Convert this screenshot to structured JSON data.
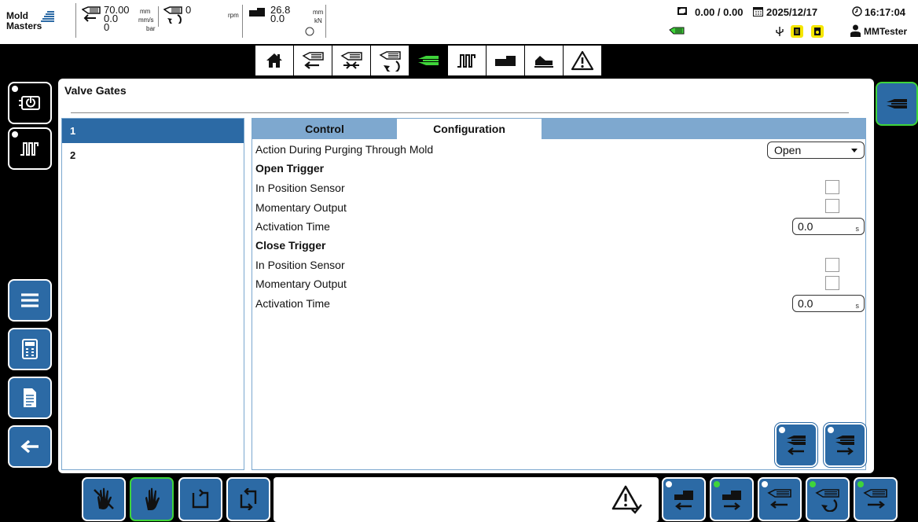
{
  "header": {
    "logo": {
      "line1": "Mold",
      "line2": "Masters"
    },
    "injection": {
      "position": "70.00",
      "speed": "0.0",
      "pressure": "0",
      "pos_unit": "mm",
      "speed_unit": "mm/s",
      "pressure_unit": "bar"
    },
    "screw": {
      "rpm_value": "0",
      "rpm_unit": "rpm"
    },
    "clamp": {
      "position": "26.8",
      "force": "0.0",
      "pos_unit": "mm",
      "force_unit": "kN"
    },
    "cycle": "0.00 / 0.00",
    "date": "2025/12/17",
    "time": "16:17:04",
    "user": "MMTester"
  },
  "nav": {
    "items": [
      "home-icon",
      "injection-icon",
      "hold-icon",
      "screw-icon",
      "valve-gate-icon",
      "temperature-icon",
      "ejector-icon",
      "graph-icon",
      "alarm-icon"
    ],
    "active_index": 4
  },
  "page": {
    "title": "Valve Gates",
    "gates": [
      "1",
      "2"
    ],
    "selected_gate": "1",
    "tabs": [
      "Control",
      "Configuration"
    ],
    "active_tab": "Configuration"
  },
  "config": {
    "purge_label": "Action During Purging Through Mold",
    "purge_value": "Open",
    "open_trigger": {
      "heading": "Open Trigger",
      "in_position_label": "In Position Sensor",
      "in_position_checked": false,
      "momentary_label": "Momentary Output",
      "momentary_checked": false,
      "activation_label": "Activation Time",
      "activation_value": "0.0",
      "activation_unit": "s"
    },
    "close_trigger": {
      "heading": "Close Trigger",
      "in_position_label": "In Position Sensor",
      "in_position_checked": false,
      "momentary_label": "Momentary Output",
      "momentary_checked": false,
      "activation_label": "Activation Time",
      "activation_value": "0.0",
      "activation_unit": "s"
    }
  },
  "colors": {
    "accent": "#2c6aa5",
    "active": "#3fd43a",
    "tabbar": "#7ea8cf",
    "highlight": "#f5e600"
  }
}
